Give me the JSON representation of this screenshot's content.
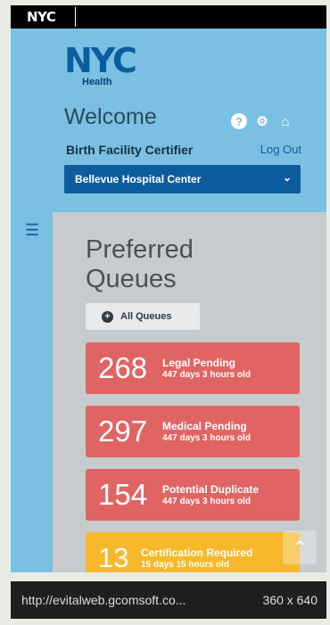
{
  "topbar": {
    "logo": "NYC"
  },
  "brand": {
    "mark": "NYC",
    "subtitle": "Health"
  },
  "header": {
    "welcome": "Welcome",
    "role": "Birth Facility Certifier",
    "logout": "Log Out",
    "facility_select": "Bellevue Hospital Center",
    "icons": [
      "help-icon",
      "gear-icon",
      "home-icon"
    ]
  },
  "main": {
    "title": "Preferred Queues",
    "all_queues_button": "All Queues",
    "queues": [
      {
        "count": "268",
        "label": "Legal Pending",
        "age": "447 days 3 hours old",
        "color": "#e16464"
      },
      {
        "count": "297",
        "label": "Medical Pending",
        "age": "447 days 3 hours old",
        "color": "#e16464"
      },
      {
        "count": "154",
        "label": "Potential Duplicate",
        "age": "447 days 3 hours old",
        "color": "#e16464"
      },
      {
        "count": "13",
        "label": "Certification Required",
        "age": "15 days 15 hours old",
        "color": "#f7b82b"
      }
    ]
  },
  "statusbar": {
    "url": "http://evitalweb.gcomsoft.co...",
    "viewport": "360 x 640"
  }
}
